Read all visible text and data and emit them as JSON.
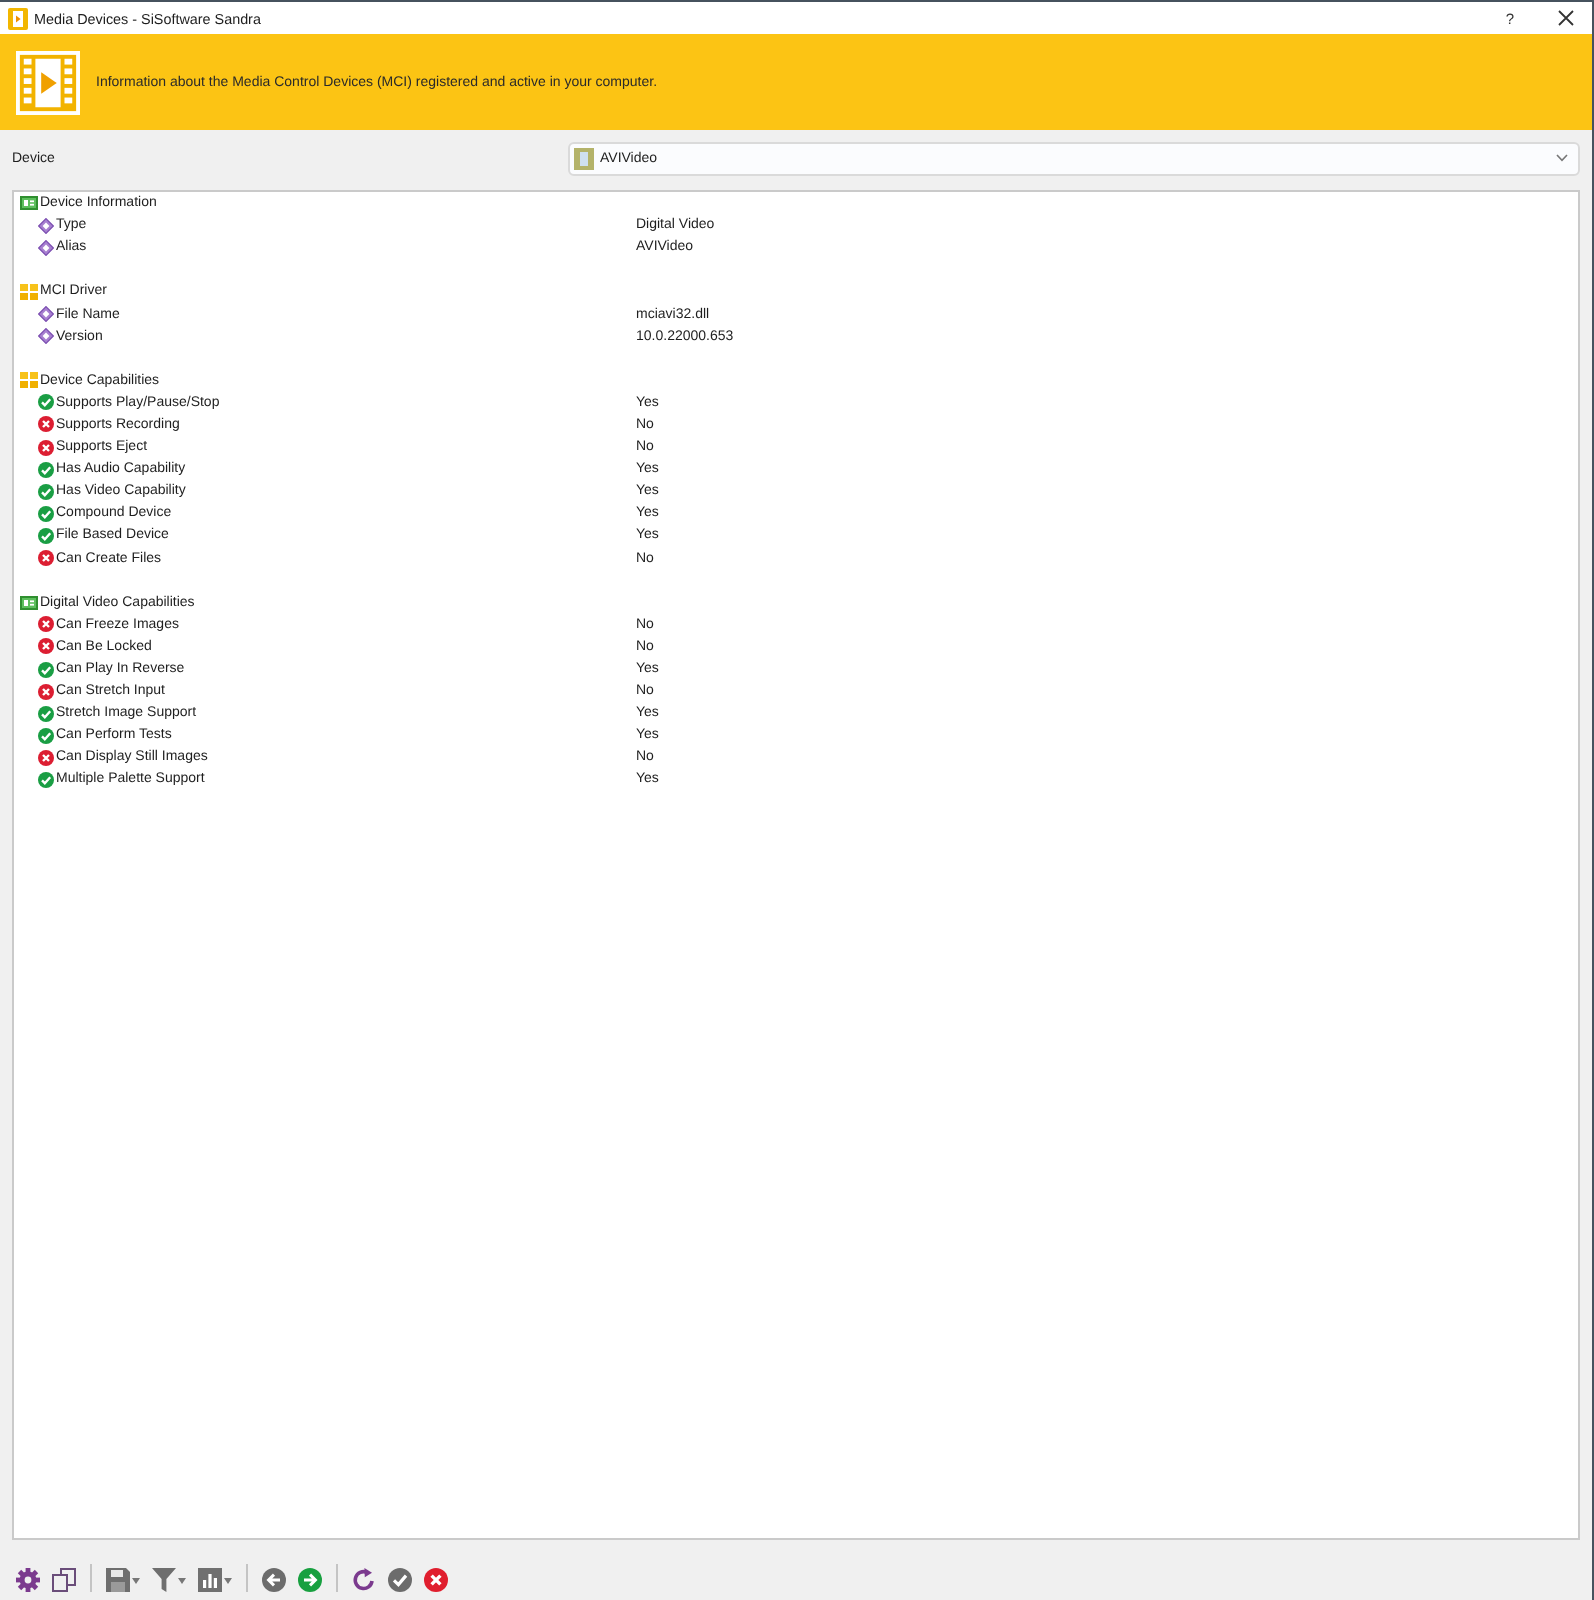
{
  "window": {
    "title": "Media Devices - SiSoftware Sandra",
    "help": "?"
  },
  "banner": {
    "text": "Information about the Media Control Devices (MCI) registered and active in your computer."
  },
  "device": {
    "label": "Device",
    "value": "AVIVideo"
  },
  "tree": [
    {
      "label": "Device Information",
      "kind": "card",
      "children": [
        {
          "label": "Type",
          "value": "Digital Video",
          "kind": "property"
        },
        {
          "label": "Alias",
          "value": "AVIVideo",
          "kind": "property"
        }
      ]
    },
    {
      "label": "MCI Driver",
      "kind": "tiles",
      "children": [
        {
          "label": "File Name",
          "value": "mciavi32.dll",
          "kind": "property"
        },
        {
          "label": "Version",
          "value": "10.0.22000.653",
          "kind": "property"
        }
      ]
    },
    {
      "label": "Device Capabilities",
      "kind": "tiles",
      "children": [
        {
          "label": "Supports Play/Pause/Stop",
          "value": "Yes",
          "kind": "capability",
          "supported": true
        },
        {
          "label": "Supports Recording",
          "value": "No",
          "kind": "capability",
          "supported": false
        },
        {
          "label": "Supports Eject",
          "value": "No",
          "kind": "capability",
          "supported": false
        },
        {
          "label": "Has Audio Capability",
          "value": "Yes",
          "kind": "capability",
          "supported": true
        },
        {
          "label": "Has Video Capability",
          "value": "Yes",
          "kind": "capability",
          "supported": true
        },
        {
          "label": "Compound Device",
          "value": "Yes",
          "kind": "capability",
          "supported": true
        },
        {
          "label": "File Based Device",
          "value": "Yes",
          "kind": "capability",
          "supported": true
        },
        {
          "label": "Can Create Files",
          "value": "No",
          "kind": "capability",
          "supported": false
        }
      ]
    },
    {
      "label": "Digital Video Capabilities",
      "kind": "card",
      "children": [
        {
          "label": "Can Freeze Images",
          "value": "No",
          "kind": "capability",
          "supported": false
        },
        {
          "label": "Can Be Locked",
          "value": "No",
          "kind": "capability",
          "supported": false
        },
        {
          "label": "Can Play In Reverse",
          "value": "Yes",
          "kind": "capability",
          "supported": true
        },
        {
          "label": "Can Stretch Input",
          "value": "No",
          "kind": "capability",
          "supported": false
        },
        {
          "label": "Stretch Image Support",
          "value": "Yes",
          "kind": "capability",
          "supported": true
        },
        {
          "label": "Can Perform Tests",
          "value": "Yes",
          "kind": "capability",
          "supported": true
        },
        {
          "label": "Can Display Still Images",
          "value": "No",
          "kind": "capability",
          "supported": false
        },
        {
          "label": "Multiple Palette Support",
          "value": "Yes",
          "kind": "capability",
          "supported": true
        }
      ]
    }
  ]
}
